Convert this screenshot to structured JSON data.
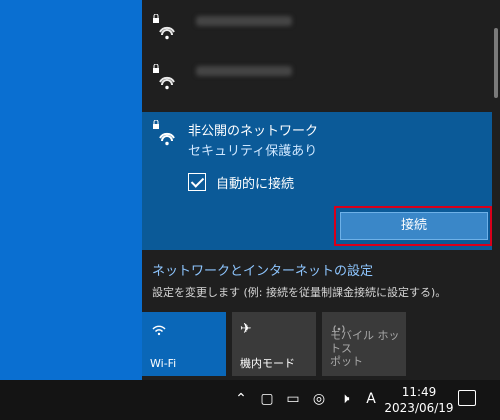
{
  "networks": [
    {
      "ssid_visible": ""
    },
    {
      "ssid_visible": ""
    }
  ],
  "selected_network": {
    "name": "非公開のネットワーク",
    "security": "セキュリティ保護あり",
    "auto_connect_label": "自動的に接続",
    "auto_connect_checked": true,
    "connect_button": "接続"
  },
  "settings": {
    "link": "ネットワークとインターネットの設定",
    "description": "設定を変更します (例: 接続を従量制課金接続に設定する)。"
  },
  "quick_tiles": [
    {
      "label": "Wi-Fi",
      "icon": "wifi-icon",
      "state": "on"
    },
    {
      "label": "機内モード",
      "icon": "airplane-icon",
      "state": "off"
    },
    {
      "label": "モバイル ホットス\nポット",
      "icon": "hotspot-icon",
      "state": "disabled"
    }
  ],
  "taskbar": {
    "ime": "A",
    "time": "11:49",
    "date": "2023/06/19"
  },
  "colors": {
    "accent": "#0a67b8",
    "selected_bg": "#0b5a98",
    "highlight_border": "#d9001b",
    "flyout_bg": "#1f1f1f"
  }
}
